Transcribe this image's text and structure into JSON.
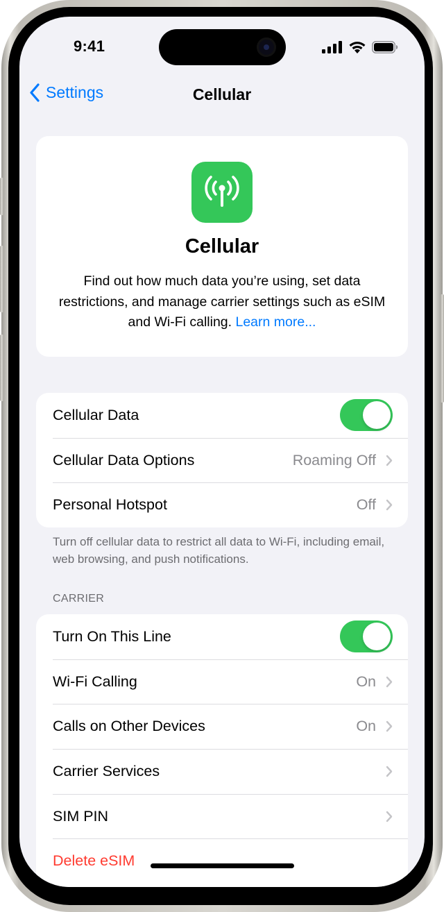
{
  "status_bar": {
    "time": "9:41",
    "icons": [
      "cellular-signal-icon",
      "wifi-icon",
      "battery-icon"
    ]
  },
  "nav": {
    "back_label": "Settings",
    "title": "Cellular"
  },
  "hero": {
    "icon": "antenna-icon",
    "icon_color": "#34c759",
    "title": "Cellular",
    "description": "Find out how much data you’re using, set data restrictions, and manage carrier settings such as eSIM and Wi-Fi calling.",
    "link_label": "Learn more..."
  },
  "group1": {
    "rows": [
      {
        "label": "Cellular Data",
        "type": "toggle",
        "on": true
      },
      {
        "label": "Cellular Data Options",
        "type": "disclosure",
        "value": "Roaming Off"
      },
      {
        "label": "Personal Hotspot",
        "type": "disclosure",
        "value": "Off"
      }
    ],
    "footer": "Turn off cellular data to restrict all data to Wi-Fi, including email, web browsing, and push notifications."
  },
  "carrier": {
    "header": "CARRIER",
    "rows": [
      {
        "label": "Turn On This Line",
        "type": "toggle",
        "on": true
      },
      {
        "label": "Wi-Fi Calling",
        "type": "disclosure",
        "value": "On"
      },
      {
        "label": "Calls on Other Devices",
        "type": "disclosure",
        "value": "On"
      },
      {
        "label": "Carrier Services",
        "type": "disclosure",
        "value": ""
      },
      {
        "label": "SIM PIN",
        "type": "disclosure",
        "value": ""
      },
      {
        "label": "Delete eSIM",
        "type": "destructive"
      }
    ]
  },
  "colors": {
    "accent": "#007aff",
    "toggle_on": "#34c759",
    "destructive": "#ff3b30",
    "background": "#f2f2f7"
  }
}
